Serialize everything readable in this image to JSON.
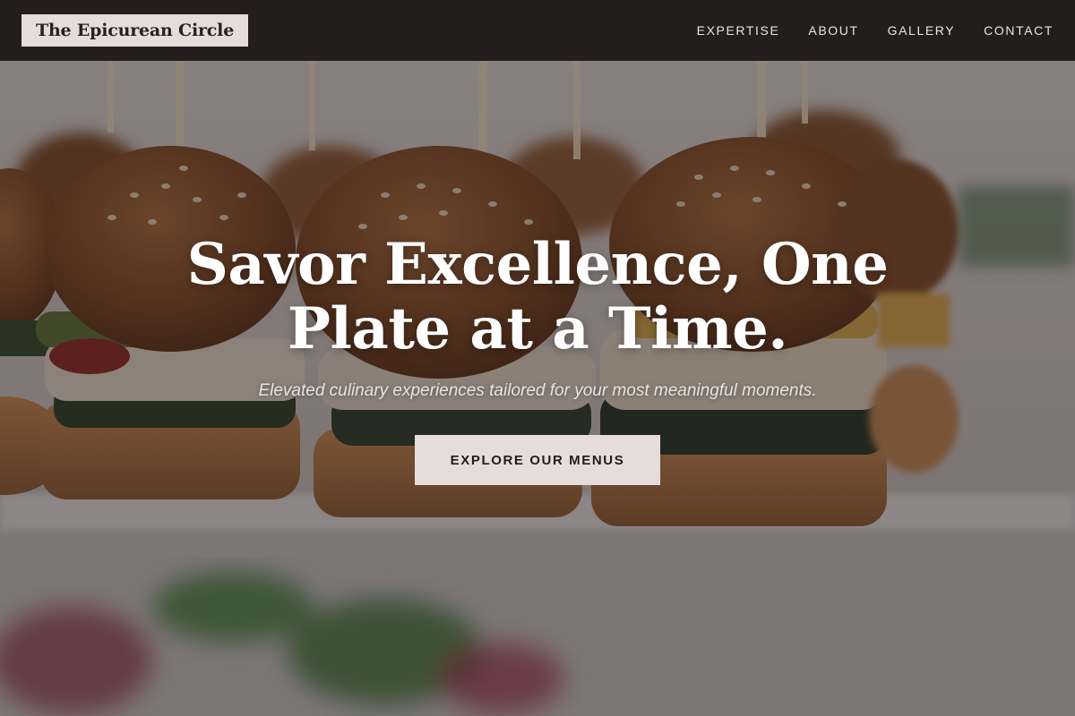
{
  "header": {
    "brand": "The Epicurean Circle",
    "nav": [
      {
        "label": "EXPERTISE"
      },
      {
        "label": "ABOUT"
      },
      {
        "label": "GALLERY"
      },
      {
        "label": "CONTACT"
      }
    ]
  },
  "hero": {
    "headline": "Savor Excellence, One\nPlate at a Time.",
    "subheadline": "Elevated culinary experiences tailored for your most meaningful moments.",
    "cta_label": "EXPLORE OUR MENUS"
  },
  "colors": {
    "header_bg": "#251c1d",
    "accent": "#e6dcdc",
    "text_light": "#ffffff"
  }
}
